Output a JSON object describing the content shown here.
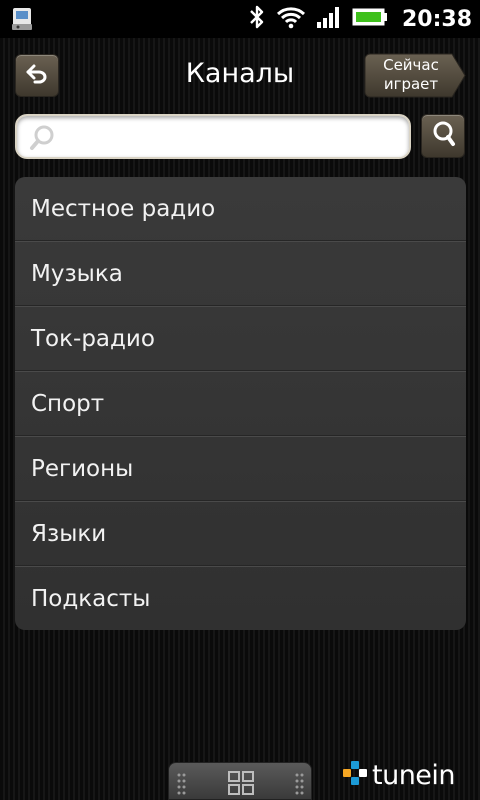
{
  "status_bar": {
    "time": "20:38",
    "icons": [
      "app-notification-icon",
      "bluetooth-icon",
      "wifi-icon",
      "signal-icon",
      "battery-icon"
    ]
  },
  "header": {
    "title": "Каналы",
    "back_icon": "back-arrow-icon",
    "now_playing_label": "Сейчас играет"
  },
  "search": {
    "placeholder": "",
    "value": "",
    "button_icon": "search-icon"
  },
  "categories": [
    "Местное радио",
    "Музыка",
    "Ток-радио",
    "Спорт",
    "Регионы",
    "Языки",
    "Подкасты"
  ],
  "footer": {
    "brand": "tunein",
    "handle_icon": "grid-icon"
  },
  "colors": {
    "button_top": "#6a6152",
    "button_bottom": "#3e382d",
    "list_bg": "#353535",
    "battery_green": "#3fc01c",
    "brand_blue": "#1c9ad6",
    "brand_orange": "#f5a623"
  }
}
